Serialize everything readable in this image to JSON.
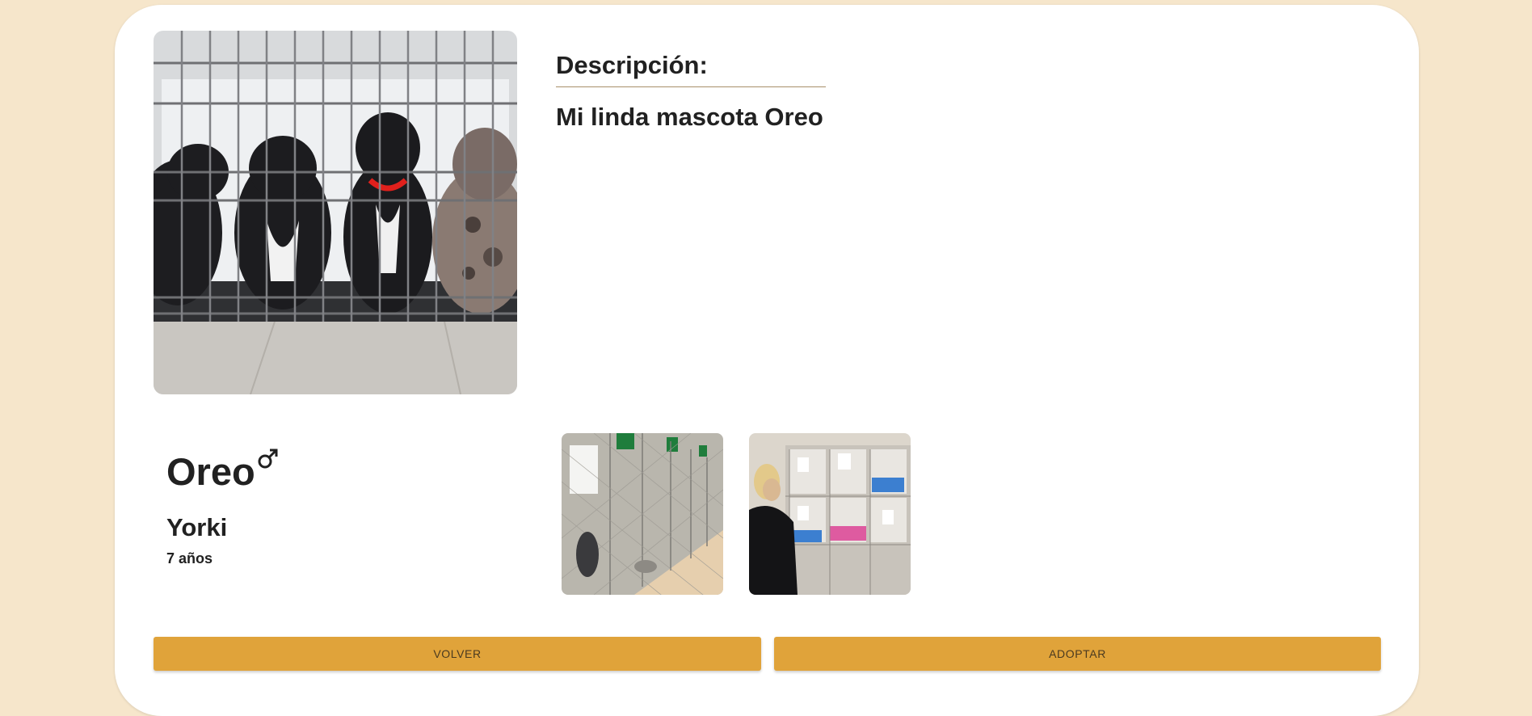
{
  "description": {
    "title": "Descripción:",
    "text": "Mi linda mascota Oreo"
  },
  "pet": {
    "name": "Oreo",
    "gender_icon": "male-symbol-icon",
    "breed": "Yorki",
    "age": "7 años"
  },
  "images": {
    "main": "puppies-in-cage-photo",
    "thumbnails": [
      "kennel-runs-photo",
      "shelter-cages-photo"
    ]
  },
  "actions": {
    "back_label": "VOLVER",
    "adopt_label": "ADOPTAR"
  },
  "colors": {
    "page_background": "#f6e6cb",
    "card_background": "#ffffff",
    "button": "#e0a33a",
    "divider": "#a8906a"
  }
}
